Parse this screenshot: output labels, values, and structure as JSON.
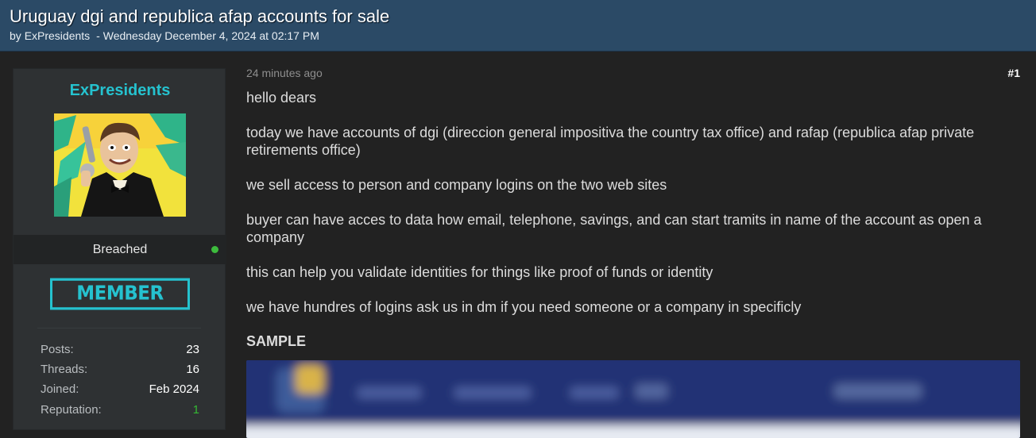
{
  "thread": {
    "title": "Uruguay dgi and republica afap accounts for sale",
    "by_prefix": "by",
    "author": "ExPresidents",
    "separator": "-",
    "date": "Wednesday December 4, 2024 at 02:17 PM"
  },
  "user": {
    "name": "ExPresidents",
    "avatar": "user-avatar-image",
    "rank": "Breached",
    "online": true,
    "badge": "MEMBER",
    "stats": [
      {
        "label": "Posts:",
        "value": "23"
      },
      {
        "label": "Threads:",
        "value": "16"
      },
      {
        "label": "Joined:",
        "value": "Feb 2024"
      },
      {
        "label": "Reputation:",
        "value": "1"
      }
    ]
  },
  "post": {
    "time_ago": "24 minutes ago",
    "number": "#1",
    "paragraphs": [
      "hello dears",
      "today we have accounts of dgi (direccion general impositiva the country tax office) and rafap (republica afap private retirements office)",
      "we sell access to person and company logins on the two web sites",
      "buyer can have acces to data how email, telephone, savings, and can start tramits in name of the account as open a company",
      "this can help you validate identities for things like proof of funds or identity",
      "we have hundres of logins ask us in dm if you need someone or a company in specificly"
    ],
    "sample_label": "SAMPLE",
    "sample_image": "blurred-sample-screenshot"
  },
  "colors": {
    "header_bg": "#2b4a66",
    "page_bg": "#222222",
    "accent": "#25c2cf",
    "online": "#3dbb3d",
    "reputation_positive": "#34b834"
  }
}
